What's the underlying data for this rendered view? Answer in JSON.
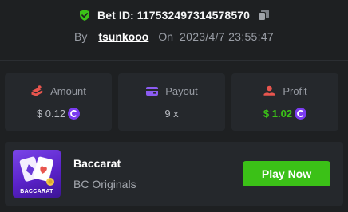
{
  "bet": {
    "id_label": "Bet ID: 117532497314578570",
    "by_label": "By",
    "username": "tsunkooo",
    "on_label": "On",
    "datetime": "2023/4/7 23:55:47"
  },
  "stats": [
    {
      "label": "Amount",
      "value": "$ 0.12",
      "icon": "coins-icon",
      "has_coin": true
    },
    {
      "label": "Payout",
      "value": "9 x",
      "icon": "wallet-icon",
      "has_coin": false
    },
    {
      "label": "Profit",
      "value": "$ 1.02",
      "icon": "profit-icon",
      "has_coin": true
    }
  ],
  "game": {
    "thumbnail_text": "BACCARAT",
    "title": "Baccarat",
    "provider": "BC Originals",
    "play_label": "Play Now"
  },
  "colors": {
    "background": "#1e2022",
    "card": "#25282c",
    "accent_green": "#3bc117",
    "coin_purple": "#7b3cf0",
    "icon_red": "#e8554e",
    "icon_purple": "#8c5cf2"
  }
}
